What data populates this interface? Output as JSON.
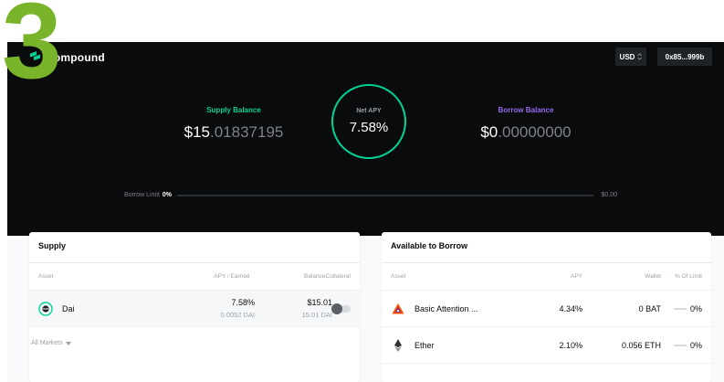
{
  "overlay": {
    "step_number": "3"
  },
  "header": {
    "logo_text": "compound",
    "currency_label": "USD",
    "wallet_address": "0x85...999b"
  },
  "balances": {
    "supply_label": "Supply Balance",
    "supply_value_main": "$15",
    "supply_value_decimals": ".01837195",
    "borrow_label": "Borrow Balance",
    "borrow_value_main": "$0",
    "borrow_value_decimals": ".00000000",
    "net_apy_label": "Net APY",
    "net_apy_value": "7.58%"
  },
  "borrow_limit": {
    "label": "Borrow Limit",
    "percent": "0%",
    "max_value": "$0.00"
  },
  "supply_card": {
    "title": "Supply",
    "columns": {
      "asset": "Asset",
      "apy": "APY / Earned",
      "balance": "Balance",
      "collateral": "Collateral"
    },
    "rows": [
      {
        "asset": "Dai",
        "apy": "7.58%",
        "earned": "0.0052 DAI",
        "balance_usd": "$15.01",
        "balance_token": "15.01 DAI",
        "collateral": false
      }
    ],
    "all_markets_label": "All Markets"
  },
  "borrow_card": {
    "title": "Available to Borrow",
    "columns": {
      "asset": "Asset",
      "apy": "APY",
      "wallet": "Wallet",
      "limit": "% Of Limit"
    },
    "rows": [
      {
        "asset": "Basic Attention ...",
        "apy": "4.34%",
        "wallet": "0 BAT",
        "limit": "0%"
      },
      {
        "asset": "Ether",
        "apy": "2.10%",
        "wallet": "0.056 ETH",
        "limit": "0%"
      }
    ]
  },
  "colors": {
    "brand_green": "#00d395",
    "borrow_purple": "#9669ed",
    "header_bg": "#0a0b0d",
    "overlay_numeral": "#79b42a"
  }
}
